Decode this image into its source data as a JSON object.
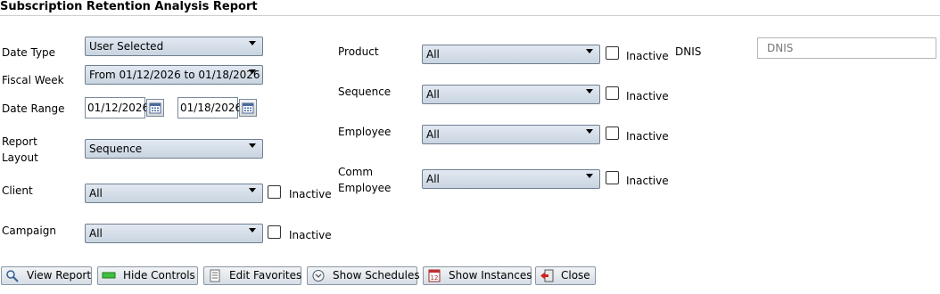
{
  "report": {
    "title": "Subscription Retention Analysis Report"
  },
  "filters": {
    "date_type": {
      "label": "Date Type",
      "value": "User Selected"
    },
    "fiscal_week": {
      "label": "Fiscal Week",
      "value": "From 01/12/2026 to 01/18/2026"
    },
    "date_range": {
      "label": "Date Range",
      "start": "01/12/2026",
      "end": "01/18/2026"
    },
    "report_layout": {
      "label_line1": "Report",
      "label_line2": "Layout",
      "value": "Sequence"
    },
    "client": {
      "label": "Client",
      "value": "All",
      "inactive_label": "Inactive"
    },
    "campaign": {
      "label": "Campaign",
      "value": "All",
      "inactive_label": "Inactive"
    },
    "product": {
      "label": "Product",
      "value": "All",
      "inactive_label": "Inactive"
    },
    "sequence": {
      "label": "Sequence",
      "value": "All",
      "inactive_label": "Inactive"
    },
    "employee": {
      "label": "Employee",
      "value": "All",
      "inactive_label": "Inactive"
    },
    "comm_employee": {
      "label_line1": "Comm",
      "label_line2": "Employee",
      "value": "All",
      "inactive_label": "Inactive"
    },
    "dnis": {
      "label": "DNIS",
      "placeholder": "DNIS"
    }
  },
  "toolbar": {
    "view_report": "View Report",
    "hide_controls": "Hide Controls",
    "edit_favorites": "Edit Favorites",
    "show_schedules": "Show Schedules",
    "show_instances": "Show Instances",
    "close": "Close"
  },
  "icons": {
    "view_report": "magnifier-icon",
    "hide_controls": "green-bar-icon",
    "edit_favorites": "document-list-icon",
    "show_schedules": "clock-chevron-icon",
    "show_instances": "calendar-icon",
    "close": "exit-door-icon",
    "calendar": "calendar-icon",
    "dropdown": "chevron-down-icon"
  },
  "colors": {
    "combo_top": "#e2e9f1",
    "combo_bottom": "#c9d4e0",
    "button_top": "#f3f5f7",
    "button_bottom": "#d6dde5",
    "border": "#6f7f92"
  }
}
